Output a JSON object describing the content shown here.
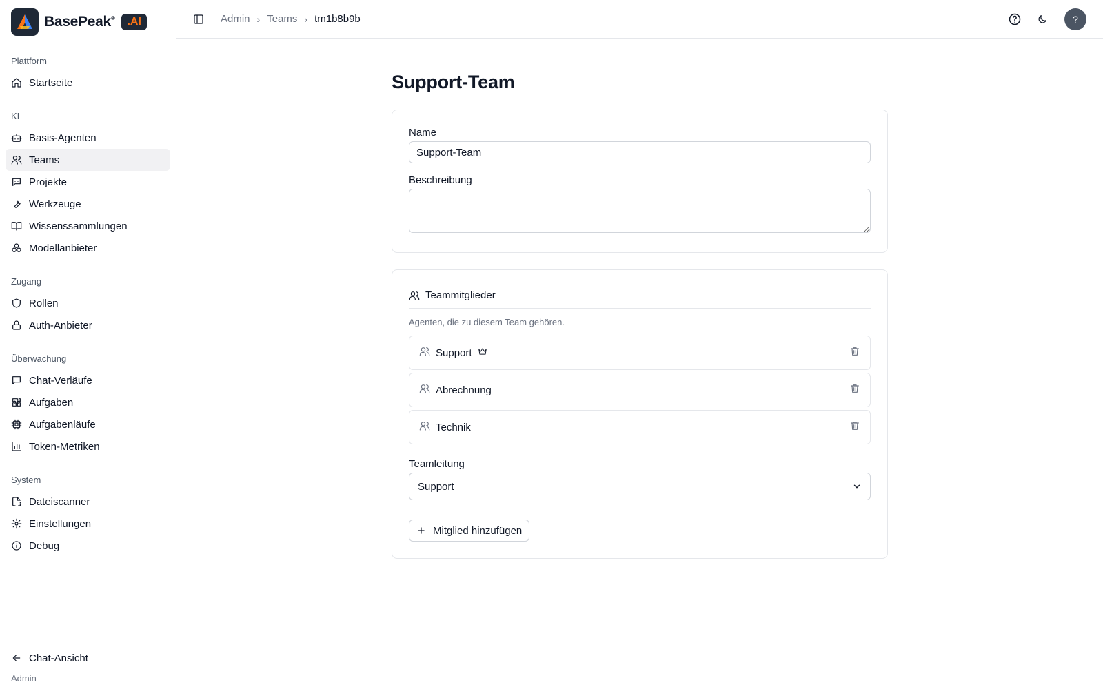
{
  "brand": {
    "name": "BasePeak",
    "mark": "®",
    "suffix": ".AI"
  },
  "sidebar": {
    "groups": [
      {
        "label": "Plattform",
        "items": [
          {
            "label": "Startseite",
            "icon": "home-icon"
          }
        ]
      },
      {
        "label": "KI",
        "items": [
          {
            "label": "Basis-Agenten",
            "icon": "bot-icon"
          },
          {
            "label": "Teams",
            "icon": "users-icon",
            "active": true
          },
          {
            "label": "Projekte",
            "icon": "message-bot-icon"
          },
          {
            "label": "Werkzeuge",
            "icon": "wrench-icon"
          },
          {
            "label": "Wissenssammlungen",
            "icon": "book-open-icon"
          },
          {
            "label": "Modellanbieter",
            "icon": "boxes-icon"
          }
        ]
      },
      {
        "label": "Zugang",
        "items": [
          {
            "label": "Rollen",
            "icon": "shield-icon"
          },
          {
            "label": "Auth-Anbieter",
            "icon": "lock-icon"
          }
        ]
      },
      {
        "label": "Überwachung",
        "items": [
          {
            "label": "Chat-Verläufe",
            "icon": "message-square-icon"
          },
          {
            "label": "Aufgaben",
            "icon": "puzzle-icon"
          },
          {
            "label": "Aufgabenläufe",
            "icon": "cpu-icon"
          },
          {
            "label": "Token-Metriken",
            "icon": "bar-chart-icon"
          }
        ]
      },
      {
        "label": "System",
        "items": [
          {
            "label": "Dateiscanner",
            "icon": "file-scan-icon"
          },
          {
            "label": "Einstellungen",
            "icon": "settings-icon"
          },
          {
            "label": "Debug",
            "icon": "info-icon"
          }
        ]
      }
    ],
    "bottom": {
      "label": "Chat-Ansicht",
      "role": "Admin"
    }
  },
  "breadcrumb": {
    "items": [
      "Admin",
      "Teams"
    ],
    "current": "tm1b8b9b"
  },
  "header": {
    "avatar": "?"
  },
  "page": {
    "title": "Support-Team",
    "name_label": "Name",
    "name_value": "Support-Team",
    "description_label": "Beschreibung",
    "description_value": ""
  },
  "members": {
    "title": "Teammitglieder",
    "description": "Agenten, die zu diesem Team gehören.",
    "items": [
      {
        "name": "Support",
        "leader": true
      },
      {
        "name": "Abrechnung",
        "leader": false
      },
      {
        "name": "Technik",
        "leader": false
      }
    ],
    "lead_label": "Teamleitung",
    "lead_value": "Support",
    "add_label": "Mitglied hinzufügen"
  }
}
